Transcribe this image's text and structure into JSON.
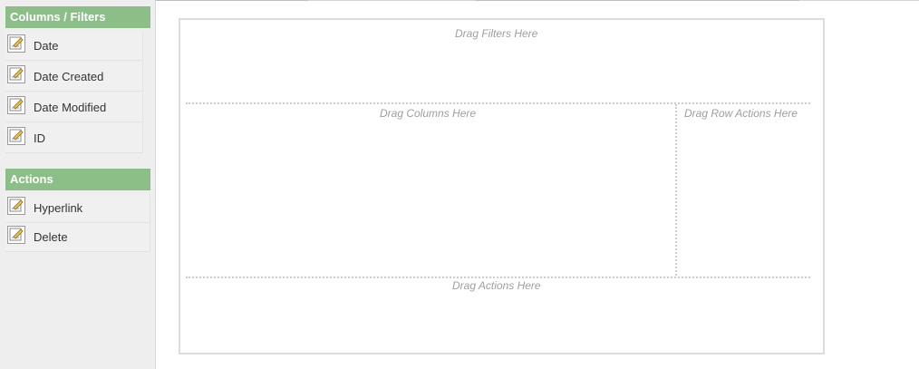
{
  "sidebar": {
    "columns_header": "Columns / Filters",
    "columns": [
      {
        "label": "Date",
        "icon": "edit-icon"
      },
      {
        "label": "Date Created",
        "icon": "edit-icon"
      },
      {
        "label": "Date Modified",
        "icon": "edit-icon"
      },
      {
        "label": "ID",
        "icon": "edit-icon"
      }
    ],
    "actions_header": "Actions",
    "actions": [
      {
        "label": "Hyperlink",
        "icon": "edit-icon"
      },
      {
        "label": "Delete",
        "icon": "edit-icon"
      }
    ]
  },
  "dropzones": {
    "filters": "Drag Filters Here",
    "columns": "Drag Columns Here",
    "row_actions": "Drag Row Actions Here",
    "actions": "Drag Actions Here"
  },
  "colors": {
    "header_green": "#8cbf88",
    "sidebar_bg": "#eeeeee",
    "hint_text": "#9e9e9e"
  }
}
